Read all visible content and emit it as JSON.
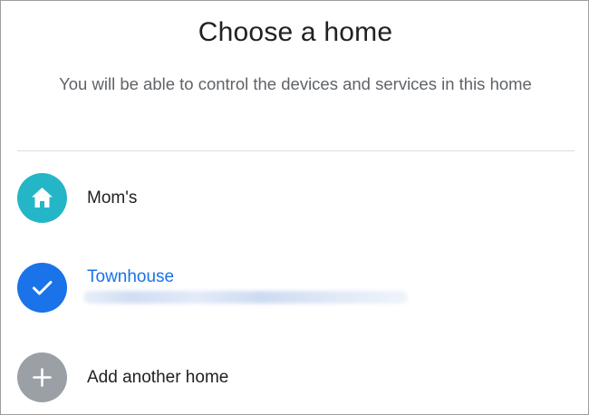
{
  "dialog": {
    "title": "Choose a home",
    "subtitle": "You will be able to control the devices and services in this home"
  },
  "homes": [
    {
      "label": "Mom's",
      "icon": "home-icon",
      "color": "#24b6c7",
      "selected": false
    },
    {
      "label": "Townhouse",
      "icon": "check-icon",
      "color": "#1a73e8",
      "selected": true
    }
  ],
  "add_home": {
    "label": "Add another home",
    "icon": "plus-icon",
    "color": "#9aa0a6"
  }
}
